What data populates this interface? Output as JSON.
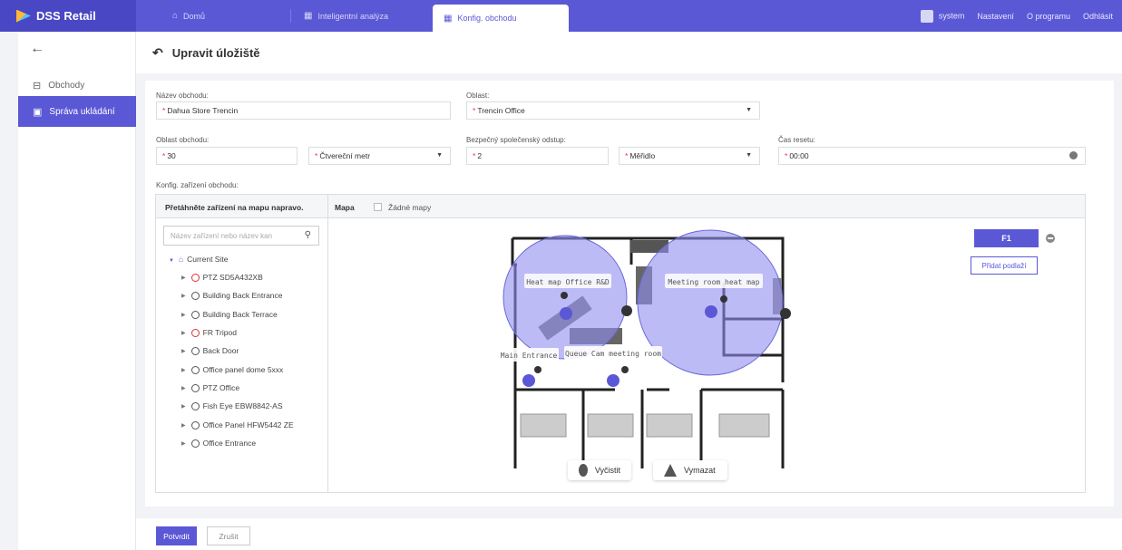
{
  "app": {
    "brand": "DSS Retail"
  },
  "tabs": [
    {
      "label": "Domů"
    },
    {
      "label": "Inteligentní analýza"
    },
    {
      "label": "Konfig. obchodu"
    }
  ],
  "topright": {
    "user": "system",
    "settings": "Nastavení",
    "about": "O programu",
    "logout": "Odhlásit"
  },
  "sidebar": {
    "items": [
      {
        "label": "Obchody"
      },
      {
        "label": "Správa ukládání"
      }
    ]
  },
  "page": {
    "title": "Upravit úložiště"
  },
  "form": {
    "store_name_label": "Název obchodu:",
    "store_name_value": "Dahua Store Trencin",
    "area_label": "Oblast:",
    "area_value": "Trencin Office",
    "store_area_label": "Oblast obchodu:",
    "store_area_value": "30",
    "unit_value": "Čtvereční metr",
    "distance_label": "Bezpečný společenský odstup:",
    "distance_value": "2",
    "distance_unit": "Měřidlo",
    "reset_label": "Čas resetu:",
    "reset_value": "00:00",
    "device_config_label": "Konfig. zařízení obchodu:"
  },
  "device_panel": {
    "drag_hint": "Přetáhněte zařízení na mapu napravo.",
    "map_label": "Mapa",
    "no_maps": "Žádné mapy",
    "search_placeholder": "Název zařízení nebo název kan",
    "root": "Current Site",
    "devices": [
      "PTZ SD5A432XB",
      "Building Back Entrance",
      "Building Back Terrace",
      "FR Tripod",
      "Back Door",
      "Office panel dome 5xxx",
      "PTZ Office",
      "Fish Eye EBW8842-AS",
      "Office Panel HFW5442 ZE",
      "Office Entrance"
    ]
  },
  "map": {
    "zones": [
      "Heat map Office R&D",
      "Meeting room heat map",
      "Main Entrance",
      "Queue Cam meeting room"
    ],
    "floor": "F1",
    "add_floor": "Přidat podlaží",
    "clear_btn": "Vyčistit",
    "delete_btn": "Vymazat",
    "zone_color": "#8f8ef0"
  },
  "footer": {
    "confirm": "Potvrdit",
    "cancel": "Zrušit"
  }
}
